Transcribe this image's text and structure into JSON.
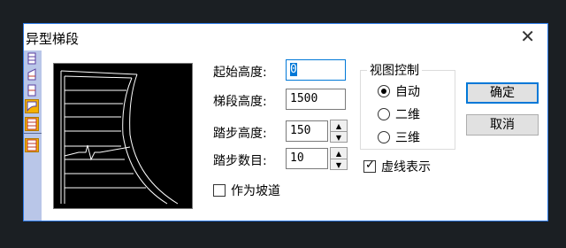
{
  "window": {
    "title": "异型梯段",
    "close_glyph": "✕"
  },
  "toolbar": {
    "icons": [
      "stair-straight-icon",
      "stair-corner-icon",
      "stair-double-icon",
      "stair-arc-icon",
      "stair-special-icon",
      "stair-special2-icon"
    ],
    "selected": [
      "stair-arc-icon",
      "stair-special-icon",
      "stair-special2-icon"
    ]
  },
  "fields": {
    "start_height": {
      "label": "起始高度:",
      "value": "0"
    },
    "run_height": {
      "label": "梯段高度:",
      "value": "1500"
    },
    "step_height": {
      "label": "踏步高度:",
      "value": "150"
    },
    "step_count": {
      "label": "踏步数目:",
      "value": "10"
    }
  },
  "as_ramp": {
    "label": "作为坡道",
    "checked": false
  },
  "view_control": {
    "title": "视图控制",
    "options": [
      {
        "label": "自动",
        "selected": true
      },
      {
        "label": "二维",
        "selected": false
      },
      {
        "label": "三维",
        "selected": false
      }
    ]
  },
  "dashed_display": {
    "label": "虚线表示",
    "checked": true
  },
  "buttons": {
    "ok": "确定",
    "cancel": "取消"
  },
  "colors": {
    "accent": "#0078d7",
    "toolstrip": "#b9c6e8",
    "preview_bg": "#000000",
    "preview_line": "#ffffff"
  }
}
